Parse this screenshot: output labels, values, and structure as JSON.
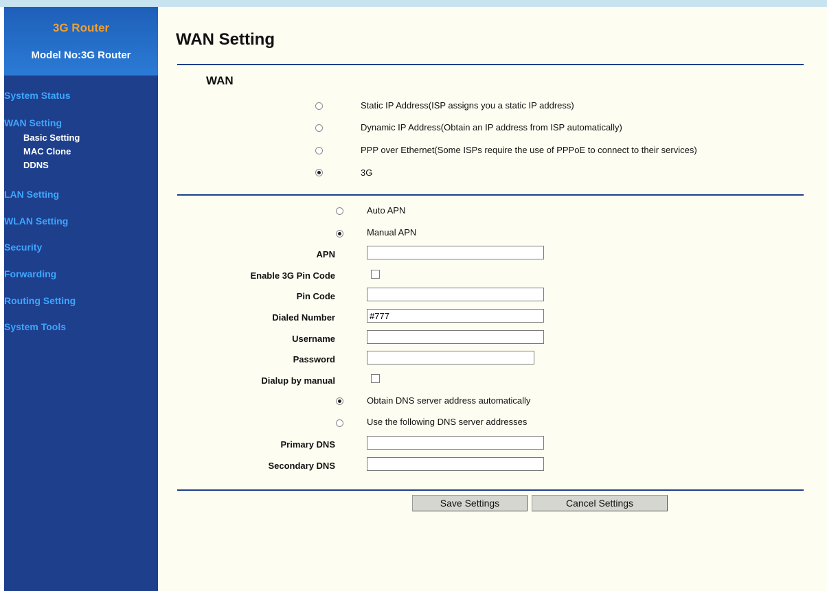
{
  "sidebar": {
    "brand_title": "3G Router",
    "model_label": "Model No:3G Router",
    "items": [
      {
        "label": "System Status"
      },
      {
        "label": "WAN Setting",
        "subitems": [
          "Basic Setting",
          "MAC Clone",
          "DDNS"
        ]
      },
      {
        "label": "LAN Setting"
      },
      {
        "label": "WLAN Setting"
      },
      {
        "label": "Security"
      },
      {
        "label": "Forwarding"
      },
      {
        "label": "Routing Setting"
      },
      {
        "label": "System Tools"
      }
    ]
  },
  "page": {
    "title": "WAN Setting",
    "section_title": "WAN"
  },
  "wan_types": [
    {
      "label": "Static IP Address(ISP assigns you a static IP address)",
      "checked": false
    },
    {
      "label": "Dynamic IP Address(Obtain an IP address from ISP automatically)",
      "checked": false
    },
    {
      "label": "PPP over Ethernet(Some ISPs require the use of PPPoE to connect to their services)",
      "checked": false
    },
    {
      "label": "3G",
      "checked": true
    }
  ],
  "apn": {
    "auto_label": "Auto APN",
    "auto_checked": false,
    "manual_label": "Manual APN",
    "manual_checked": true
  },
  "fields": {
    "apn": {
      "label": "APN",
      "value": ""
    },
    "enable_pin": {
      "label": "Enable 3G Pin Code",
      "checked": false
    },
    "pin_code": {
      "label": "Pin Code",
      "value": ""
    },
    "dialed_number": {
      "label": "Dialed Number",
      "value": "#777"
    },
    "username": {
      "label": "Username",
      "value": ""
    },
    "password": {
      "label": "Password",
      "value": ""
    },
    "dialup_manual": {
      "label": "Dialup by manual",
      "checked": false
    },
    "primary_dns": {
      "label": "Primary DNS",
      "value": ""
    },
    "secondary_dns": {
      "label": "Secondary DNS",
      "value": ""
    }
  },
  "dns": {
    "auto_label": "Obtain DNS server address automatically",
    "auto_checked": true,
    "manual_label": "Use the following DNS server addresses",
    "manual_checked": false
  },
  "buttons": {
    "save": "Save Settings",
    "cancel": "Cancel Settings"
  }
}
